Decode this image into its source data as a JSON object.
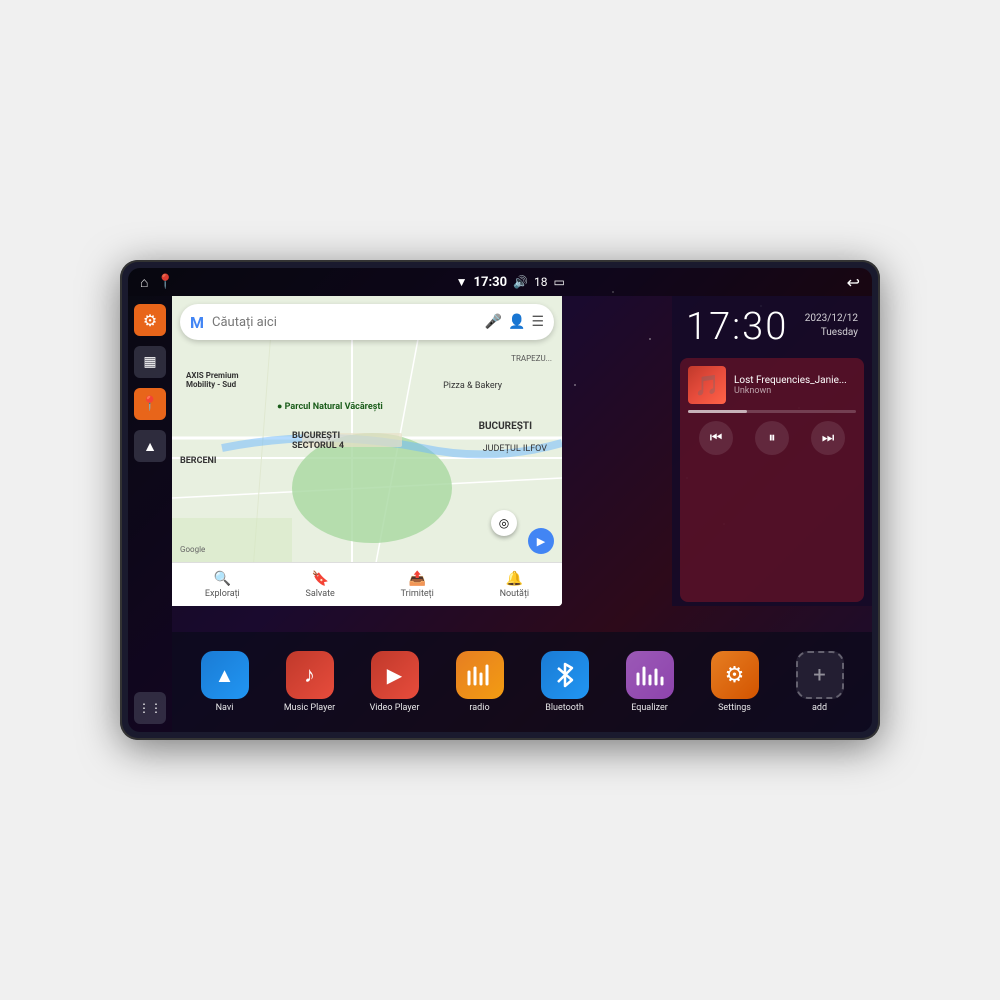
{
  "device": {
    "screen": {
      "background": "dark space"
    }
  },
  "status_bar": {
    "wifi_icon": "▼",
    "time": "17:30",
    "volume_icon": "🔊",
    "battery_level": "18",
    "battery_icon": "🔋",
    "back_icon": "↩"
  },
  "sidebar": {
    "settings_icon": "⚙",
    "files_icon": "▦",
    "location_icon": "📍",
    "navigation_icon": "▲",
    "grid_icon": "⋮⋮⋮"
  },
  "map": {
    "search_placeholder": "Căutați aici",
    "search_icon": "M",
    "mic_icon": "🎤",
    "account_icon": "👤",
    "menu_icon": "☰",
    "places": [
      "AXIS Premium Mobility - Sud",
      "Parcul Natural Văcărești",
      "Pizza & Bakery",
      "BUCUREȘTI SECTORUL 4",
      "BUCUREȘTI",
      "JUDEȚUL ILFOV",
      "BERCENI"
    ],
    "tabs": [
      {
        "label": "Explorați",
        "icon": "🔍"
      },
      {
        "label": "Salvate",
        "icon": "🔖"
      },
      {
        "label": "Trimiteți",
        "icon": "📤"
      },
      {
        "label": "Noutăți",
        "icon": "🔔"
      }
    ],
    "google_label": "Google"
  },
  "clock": {
    "time": "17:30",
    "date": "2023/12/12",
    "day": "Tuesday"
  },
  "music_player": {
    "track_name": "Lost Frequencies_Janie...",
    "artist": "Unknown",
    "prev_icon": "⏮",
    "pause_icon": "⏸",
    "next_icon": "⏭",
    "progress_percent": 35
  },
  "apps": [
    {
      "id": "navi",
      "label": "Navi",
      "icon": "▲",
      "style": "blue-nav"
    },
    {
      "id": "music-player",
      "label": "Music Player",
      "icon": "♪",
      "style": "red-music"
    },
    {
      "id": "video-player",
      "label": "Video Player",
      "icon": "▶",
      "style": "red-video"
    },
    {
      "id": "radio",
      "label": "radio",
      "icon": "📶",
      "style": "orange-radio"
    },
    {
      "id": "bluetooth",
      "label": "Bluetooth",
      "icon": "⚡",
      "style": "blue-bt"
    },
    {
      "id": "equalizer",
      "label": "Equalizer",
      "icon": "≡",
      "style": "pink-eq"
    },
    {
      "id": "settings",
      "label": "Settings",
      "icon": "⚙",
      "style": "orange-settings"
    },
    {
      "id": "add",
      "label": "add",
      "icon": "+",
      "style": "add-icon"
    }
  ]
}
